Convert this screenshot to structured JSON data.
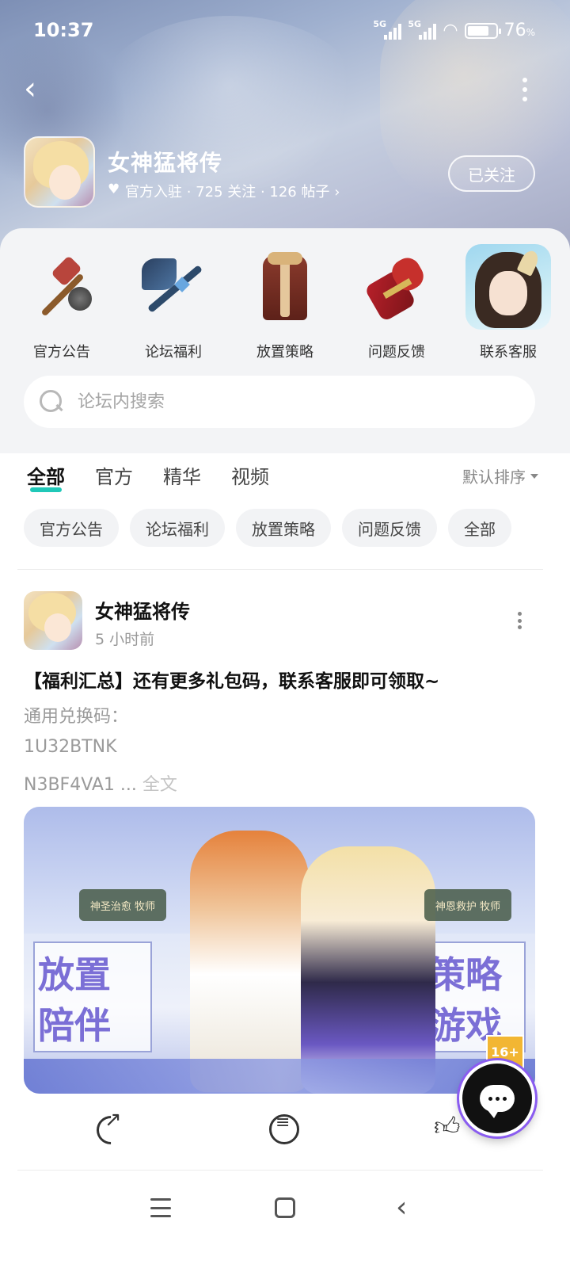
{
  "status_bar": {
    "time": "10:37",
    "signal1_label": "5G",
    "signal2_label": "5G",
    "battery_percent": "76",
    "battery_unit": "%",
    "battery_level": 0.76
  },
  "header": {
    "forum_name": "女神猛将传",
    "meta_text": "官方入驻 · 725 关注 · 126 帖子 ›",
    "follow_label": "已关注"
  },
  "categories": [
    {
      "label": "官方公告",
      "icon": "hammer-icon"
    },
    {
      "label": "论坛福利",
      "icon": "axe-icon"
    },
    {
      "label": "放置策略",
      "icon": "robe-icon"
    },
    {
      "label": "问题反馈",
      "icon": "gauntlet-icon"
    },
    {
      "label": "联系客服",
      "icon": "character-avatar-icon"
    }
  ],
  "search": {
    "placeholder": "论坛内搜索"
  },
  "tabs": [
    "全部",
    "官方",
    "精华",
    "视频"
  ],
  "sort_label": "默认排序",
  "chips": [
    "官方公告",
    "论坛福利",
    "放置策略",
    "问题反馈",
    "全部"
  ],
  "post": {
    "author": "女神猛将传",
    "time": "5 小时前",
    "title": "【福利汇总】还有更多礼包码，联系客服即可领取~",
    "line1": "通用兑换码：",
    "line2": "1U32BTNK",
    "line3": "N3BF4VA1 ...",
    "full_text_link": "全文",
    "image": {
      "badge_left": "神圣治愈 牧师",
      "badge_right": "神恩救护 牧师",
      "left_text_1": "放置",
      "left_text_2": "陪伴",
      "right_text_1": "策略",
      "right_text_2": "游戏",
      "age_rating": "16+"
    }
  }
}
